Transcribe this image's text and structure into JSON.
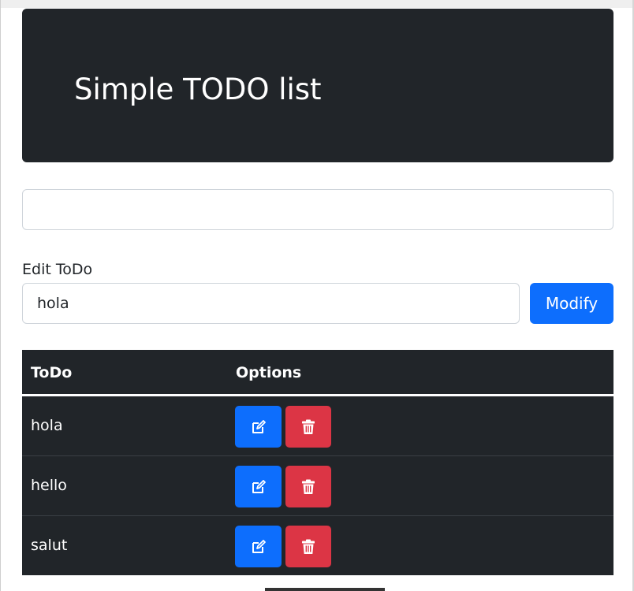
{
  "header": {
    "title": "Simple TODO list"
  },
  "new_todo": {
    "value": "",
    "placeholder": ""
  },
  "edit": {
    "label": "Edit ToDo",
    "value": "hola",
    "button_label": "Modify"
  },
  "table": {
    "headers": {
      "todo": "ToDo",
      "options": "Options"
    },
    "rows": [
      {
        "text": "hola",
        "edit_icon": "edit-icon",
        "delete_icon": "trash-icon"
      },
      {
        "text": "hello",
        "edit_icon": "edit-icon",
        "delete_icon": "trash-icon"
      },
      {
        "text": "salut",
        "edit_icon": "edit-icon",
        "delete_icon": "trash-icon"
      }
    ]
  },
  "colors": {
    "dark": "#212529",
    "primary": "#0d6efd",
    "danger": "#dc3545"
  }
}
